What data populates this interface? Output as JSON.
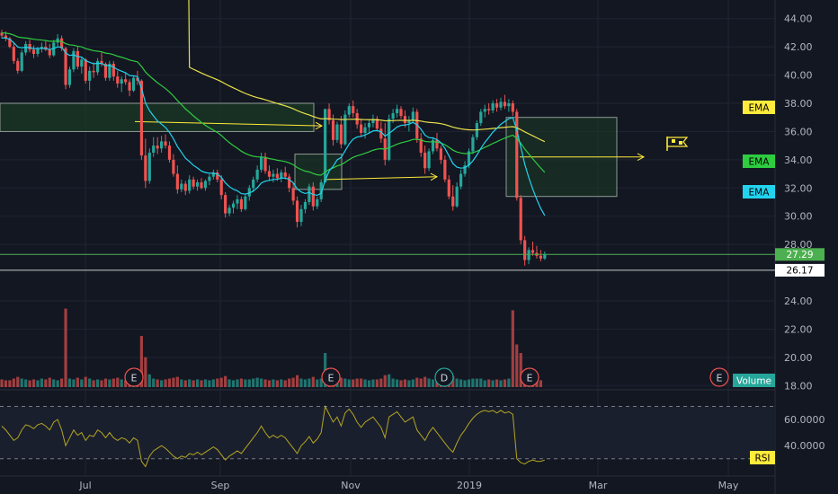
{
  "colors": {
    "background": "#131722",
    "grid": "#1f2433",
    "axis_text": "#b2b5be",
    "up": "#26a69a",
    "down": "#ef5350",
    "ema_yellow": "#e8e24a",
    "ema_green": "#2ecc40",
    "ema_cyan": "#22d3ee",
    "rsi_line": "#b3a521",
    "annotation": "#ffeb3b",
    "box_fill": "#1b3a26",
    "price_line": "#4caf50",
    "ref_line": "#c9c9c9"
  },
  "chart_data": {
    "type": "candlestick",
    "price_axis": {
      "ticks": [
        "44.00",
        "42.00",
        "40.00",
        "38.00",
        "36.00",
        "34.00",
        "32.00",
        "30.00",
        "28.00",
        "24.00",
        "22.00",
        "20.00",
        "18.00"
      ],
      "ylim": [
        17,
        45
      ]
    },
    "rsi_axis": {
      "ticks": [
        "60.0000",
        "40.0000"
      ],
      "ylim": [
        25,
        80
      ]
    },
    "x_axis": {
      "labels": [
        "Jul",
        "Sep",
        "Nov",
        "2019",
        "Mar",
        "May"
      ]
    },
    "candles": [
      [
        43.0,
        43.2,
        42.6,
        42.8
      ],
      [
        42.8,
        43.1,
        42.4,
        42.6
      ],
      [
        42.6,
        42.7,
        41.9,
        42.0
      ],
      [
        42.0,
        42.3,
        40.8,
        41.0
      ],
      [
        41.0,
        41.2,
        40.1,
        40.3
      ],
      [
        40.3,
        41.8,
        40.2,
        41.6
      ],
      [
        41.6,
        42.4,
        41.4,
        42.2
      ],
      [
        42.2,
        42.5,
        41.6,
        41.8
      ],
      [
        41.8,
        42.1,
        41.2,
        41.5
      ],
      [
        41.5,
        42.0,
        41.3,
        41.9
      ],
      [
        41.9,
        42.3,
        41.6,
        42.0
      ],
      [
        42.0,
        42.4,
        41.7,
        41.8
      ],
      [
        41.8,
        42.2,
        41.2,
        41.4
      ],
      [
        41.4,
        42.5,
        41.3,
        42.3
      ],
      [
        42.3,
        42.9,
        42.0,
        42.6
      ],
      [
        42.6,
        42.8,
        41.7,
        41.9
      ],
      [
        41.9,
        42.0,
        39.0,
        39.3
      ],
      [
        39.3,
        40.6,
        39.1,
        40.4
      ],
      [
        40.4,
        41.9,
        40.2,
        41.7
      ],
      [
        41.7,
        42.0,
        40.4,
        40.6
      ],
      [
        40.6,
        41.3,
        40.1,
        41.1
      ],
      [
        41.1,
        41.2,
        39.4,
        39.6
      ],
      [
        39.6,
        40.6,
        38.9,
        40.3
      ],
      [
        40.3,
        40.9,
        39.8,
        40.2
      ],
      [
        40.2,
        41.2,
        40.0,
        41.0
      ],
      [
        41.0,
        41.6,
        40.6,
        40.8
      ],
      [
        40.8,
        40.9,
        39.6,
        39.8
      ],
      [
        39.8,
        41.0,
        39.6,
        40.8
      ],
      [
        40.8,
        41.0,
        39.6,
        39.9
      ],
      [
        39.9,
        40.3,
        39.1,
        39.4
      ],
      [
        39.4,
        39.9,
        38.8,
        39.7
      ],
      [
        39.7,
        40.2,
        39.3,
        39.5
      ],
      [
        39.5,
        39.7,
        38.5,
        38.9
      ],
      [
        38.9,
        39.9,
        38.8,
        39.8
      ],
      [
        39.8,
        40.3,
        39.3,
        39.6
      ],
      [
        39.6,
        39.7,
        34.0,
        34.3
      ],
      [
        34.3,
        35.5,
        32.0,
        32.5
      ],
      [
        32.5,
        34.8,
        32.3,
        34.5
      ],
      [
        34.5,
        35.6,
        34.2,
        35.0
      ],
      [
        35.0,
        35.6,
        34.4,
        34.8
      ],
      [
        34.8,
        35.7,
        34.5,
        35.3
      ],
      [
        35.3,
        35.8,
        34.8,
        35.0
      ],
      [
        35.0,
        35.3,
        33.8,
        34.0
      ],
      [
        34.0,
        34.4,
        32.8,
        33.0
      ],
      [
        33.0,
        33.6,
        31.6,
        31.9
      ],
      [
        31.9,
        32.6,
        31.7,
        32.3
      ],
      [
        32.3,
        32.5,
        31.5,
        31.8
      ],
      [
        31.8,
        32.9,
        31.6,
        32.6
      ],
      [
        32.6,
        32.8,
        31.9,
        32.1
      ],
      [
        32.1,
        32.6,
        31.8,
        32.4
      ],
      [
        32.4,
        32.7,
        31.9,
        32.0
      ],
      [
        32.0,
        32.6,
        31.8,
        32.5
      ],
      [
        32.5,
        33.0,
        32.2,
        32.8
      ],
      [
        32.8,
        33.3,
        32.6,
        33.1
      ],
      [
        33.1,
        33.3,
        32.4,
        32.6
      ],
      [
        32.6,
        32.9,
        31.2,
        31.5
      ],
      [
        31.5,
        31.7,
        29.9,
        30.2
      ],
      [
        30.2,
        30.8,
        30.0,
        30.6
      ],
      [
        30.6,
        31.1,
        30.2,
        30.9
      ],
      [
        30.9,
        31.5,
        30.5,
        31.2
      ],
      [
        31.2,
        31.4,
        30.3,
        30.5
      ],
      [
        30.5,
        31.6,
        30.4,
        31.4
      ],
      [
        31.4,
        32.2,
        31.1,
        32.0
      ],
      [
        32.0,
        32.8,
        31.7,
        32.6
      ],
      [
        32.6,
        33.6,
        32.4,
        33.3
      ],
      [
        33.3,
        34.5,
        33.1,
        34.2
      ],
      [
        34.2,
        34.5,
        33.0,
        33.2
      ],
      [
        33.2,
        33.6,
        32.5,
        32.8
      ],
      [
        32.8,
        33.3,
        32.4,
        33.0
      ],
      [
        33.0,
        33.4,
        32.5,
        32.7
      ],
      [
        32.7,
        33.3,
        32.4,
        33.1
      ],
      [
        33.1,
        33.5,
        32.6,
        32.8
      ],
      [
        32.8,
        33.0,
        31.7,
        32.0
      ],
      [
        32.0,
        32.4,
        30.8,
        31.1
      ],
      [
        31.1,
        31.4,
        29.2,
        29.6
      ],
      [
        29.6,
        30.8,
        29.3,
        30.5
      ],
      [
        30.5,
        31.2,
        30.2,
        31.0
      ],
      [
        31.0,
        32.3,
        30.8,
        32.1
      ],
      [
        32.1,
        32.4,
        30.4,
        30.7
      ],
      [
        30.7,
        31.4,
        30.5,
        31.2
      ],
      [
        31.2,
        32.6,
        31.0,
        32.4
      ],
      [
        32.4,
        32.6,
        34.8,
        37.6
      ],
      [
        37.6,
        38.0,
        36.5,
        36.8
      ],
      [
        36.8,
        37.2,
        35.0,
        35.4
      ],
      [
        35.4,
        36.7,
        35.2,
        36.5
      ],
      [
        36.5,
        37.1,
        34.8,
        35.1
      ],
      [
        35.1,
        37.5,
        35.0,
        37.2
      ],
      [
        37.2,
        38.0,
        37.0,
        37.8
      ],
      [
        37.8,
        38.2,
        37.0,
        37.3
      ],
      [
        37.3,
        37.6,
        36.2,
        36.5
      ],
      [
        36.5,
        36.9,
        35.6,
        35.9
      ],
      [
        35.9,
        36.6,
        35.5,
        36.3
      ],
      [
        36.3,
        36.8,
        35.9,
        36.6
      ],
      [
        36.6,
        37.2,
        36.3,
        36.9
      ],
      [
        36.9,
        37.1,
        36.0,
        36.2
      ],
      [
        36.2,
        36.7,
        35.2,
        35.5
      ],
      [
        35.5,
        36.6,
        33.6,
        34.0
      ],
      [
        34.0,
        37.2,
        33.9,
        36.9
      ],
      [
        36.9,
        37.6,
        36.6,
        37.3
      ],
      [
        37.3,
        37.9,
        37.0,
        37.6
      ],
      [
        37.6,
        37.8,
        36.9,
        37.1
      ],
      [
        37.1,
        37.5,
        36.3,
        36.6
      ],
      [
        36.6,
        37.1,
        36.0,
        36.8
      ],
      [
        36.8,
        37.7,
        36.6,
        37.4
      ],
      [
        37.4,
        37.6,
        35.2,
        35.5
      ],
      [
        35.5,
        35.9,
        34.2,
        34.5
      ],
      [
        34.5,
        35.0,
        33.0,
        33.4
      ],
      [
        33.4,
        34.8,
        33.2,
        34.6
      ],
      [
        34.6,
        35.6,
        34.4,
        35.4
      ],
      [
        35.4,
        35.9,
        34.6,
        34.8
      ],
      [
        34.8,
        35.0,
        33.7,
        34.0
      ],
      [
        34.0,
        34.3,
        32.4,
        32.6
      ],
      [
        32.6,
        32.9,
        31.2,
        31.4
      ],
      [
        31.4,
        32.2,
        30.4,
        30.7
      ],
      [
        30.7,
        32.4,
        30.6,
        32.1
      ],
      [
        32.1,
        33.3,
        31.9,
        33.0
      ],
      [
        33.0,
        33.9,
        32.8,
        33.6
      ],
      [
        33.6,
        34.8,
        33.4,
        34.6
      ],
      [
        34.6,
        35.8,
        34.4,
        35.6
      ],
      [
        35.6,
        36.8,
        35.4,
        36.6
      ],
      [
        36.6,
        37.6,
        36.4,
        37.4
      ],
      [
        37.4,
        37.9,
        37.0,
        37.6
      ],
      [
        37.6,
        38.0,
        37.2,
        37.5
      ],
      [
        37.5,
        38.2,
        37.3,
        38.0
      ],
      [
        38.0,
        38.3,
        37.4,
        37.7
      ],
      [
        37.7,
        38.4,
        37.5,
        38.1
      ],
      [
        38.1,
        38.6,
        37.6,
        37.8
      ],
      [
        37.8,
        38.3,
        37.4,
        38.0
      ],
      [
        38.0,
        38.2,
        37.1,
        37.4
      ],
      [
        37.4,
        37.6,
        31.1,
        31.3
      ],
      [
        31.3,
        31.5,
        28.0,
        28.3
      ],
      [
        28.3,
        28.6,
        26.5,
        26.9
      ],
      [
        26.9,
        27.8,
        26.6,
        27.6
      ],
      [
        27.6,
        28.2,
        27.2,
        27.4
      ],
      [
        27.4,
        27.9,
        27.0,
        27.2
      ],
      [
        27.2,
        27.6,
        26.8,
        27.0
      ],
      [
        27.0,
        27.5,
        26.9,
        27.3
      ]
    ],
    "volume": [
      0.9,
      0.8,
      0.8,
      1.0,
      1.2,
      1.0,
      0.9,
      0.8,
      0.9,
      0.8,
      1.0,
      0.9,
      1.1,
      0.9,
      0.8,
      1.0,
      1.7,
      1.0,
      0.9,
      1.1,
      0.9,
      1.2,
      1.0,
      0.8,
      0.9,
      0.8,
      1.0,
      0.9,
      1.0,
      1.1,
      0.9,
      0.8,
      1.0,
      0.9,
      0.8,
      6.0,
      3.5,
      1.5,
      1.0,
      0.9,
      0.8,
      0.9,
      1.0,
      1.1,
      1.2,
      0.9,
      0.8,
      0.9,
      0.8,
      0.9,
      0.8,
      0.9,
      0.8,
      0.9,
      1.0,
      1.1,
      1.3,
      0.9,
      0.8,
      0.9,
      1.0,
      0.9,
      0.9,
      1.0,
      1.1,
      1.0,
      0.9,
      0.8,
      0.9,
      0.8,
      0.9,
      0.8,
      1.0,
      1.1,
      1.4,
      1.0,
      0.9,
      1.0,
      1.2,
      0.9,
      1.0,
      4.0,
      1.6,
      1.3,
      1.0,
      1.1,
      1.0,
      0.9,
      0.9,
      1.0,
      1.0,
      0.9,
      0.8,
      0.9,
      0.9,
      1.0,
      1.4,
      1.5,
      1.0,
      0.9,
      0.8,
      0.9,
      0.8,
      0.9,
      1.1,
      1.0,
      1.2,
      1.0,
      0.9,
      0.9,
      1.0,
      1.1,
      1.2,
      1.3,
      1.0,
      0.9,
      0.8,
      0.9,
      1.0,
      1.0,
      1.0,
      0.8,
      0.9,
      0.8,
      0.9,
      0.8,
      0.9,
      1.0,
      9.0,
      5.0,
      4.0,
      1.2,
      1.0,
      0.8,
      0.9,
      0.8
    ],
    "vol_spike_first": 9.2,
    "rsi": [
      55,
      52,
      48,
      44,
      46,
      52,
      56,
      55,
      53,
      56,
      57,
      55,
      52,
      58,
      60,
      52,
      40,
      46,
      52,
      48,
      50,
      44,
      48,
      47,
      52,
      50,
      46,
      50,
      46,
      44,
      46,
      45,
      42,
      46,
      44,
      28,
      24,
      32,
      36,
      38,
      40,
      38,
      35,
      32,
      30,
      32,
      31,
      34,
      33,
      35,
      33,
      35,
      37,
      39,
      37,
      33,
      29,
      32,
      34,
      36,
      34,
      38,
      42,
      46,
      50,
      55,
      50,
      46,
      48,
      46,
      48,
      46,
      42,
      38,
      34,
      40,
      43,
      47,
      42,
      45,
      50,
      70,
      64,
      58,
      62,
      55,
      65,
      68,
      64,
      58,
      54,
      58,
      60,
      62,
      58,
      54,
      46,
      62,
      64,
      66,
      62,
      58,
      60,
      62,
      52,
      48,
      44,
      50,
      54,
      50,
      46,
      42,
      38,
      35,
      42,
      48,
      52,
      57,
      61,
      64,
      66,
      67,
      66,
      67,
      65,
      67,
      65,
      66,
      64,
      30,
      27,
      26,
      28,
      29,
      28,
      28,
      29
    ],
    "emas": [
      {
        "label": "EMA",
        "start": [
          43.4,
          42.0
        ],
        "end": [
          36.9,
          38.0
        ]
      },
      {
        "label": "EMA",
        "start": [
          43.0,
          42.6
        ],
        "end": [
          32.9,
          36.3
        ]
      },
      {
        "label": "EMA",
        "start": [
          42.6,
          42.6
        ],
        "end": [
          31.0,
          36.6
        ]
      }
    ],
    "last_price": "27.29",
    "ref_price": "26.17",
    "earnings_markers": [
      "E",
      "E",
      "D",
      "E",
      "E"
    ],
    "volume_label": "Volume",
    "rsi_label": "RSI",
    "rsi_levels": [
      70,
      30
    ]
  }
}
